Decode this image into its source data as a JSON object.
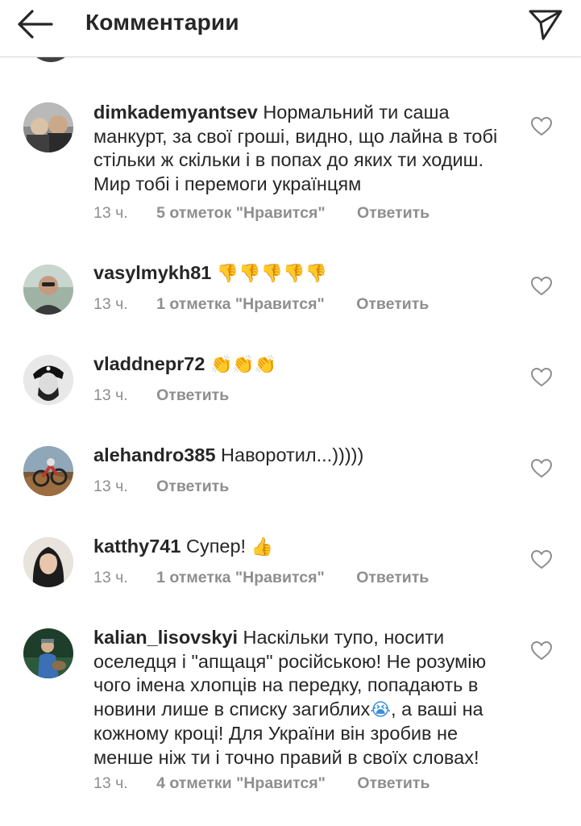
{
  "header": {
    "title": "Комментарии",
    "back_icon": "arrow-left-icon",
    "send_icon": "paper-plane-icon"
  },
  "colors": {
    "text": "#262626",
    "meta": "#8e8e8e",
    "divider": "#dbdbdb",
    "emoji": "#f4b400"
  },
  "comments": [
    {
      "username": "dimkademyantsev",
      "text": "Нормальний ти саша манкурт, за свої гроші, видно, що лайна в тобі стільки ж скільки і в попах до яких ти ходиш. Мир тобі і перемоги українцям",
      "emoji": "",
      "text_after": "",
      "time": "13 ч.",
      "likes": "5 отметок \"Нравится\"",
      "reply": "Ответить"
    },
    {
      "username": "vasylmykh81",
      "text": "",
      "emoji": "👎👎👎👎👎",
      "text_after": "",
      "time": "13 ч.",
      "likes": "1 отметка \"Нравится\"",
      "reply": "Ответить"
    },
    {
      "username": "vladdnepr72",
      "text": "",
      "emoji": "👏👏👏",
      "text_after": "",
      "time": "13 ч.",
      "likes": "",
      "reply": "Ответить"
    },
    {
      "username": "alehandro385",
      "text": "Наворотил...)))))",
      "emoji": "",
      "text_after": "",
      "time": "13 ч.",
      "likes": "",
      "reply": "Ответить"
    },
    {
      "username": "katthy741",
      "text": "Супер!",
      "emoji": "👍",
      "text_after": "",
      "time": "13 ч.",
      "likes": "1 отметка \"Нравится\"",
      "reply": "Ответить"
    },
    {
      "username": "kalian_lisovskyi",
      "text": "Наскільки тупо, носити оселедця і \"апщаця\" російською! Не розумію чого імена хлопців на передку, попадають в новини лише в списку загиблих",
      "emoji": "😭",
      "text_after": ", а ваші на кожному кроці! Для України він зробив не менше ніж ти і точно правий в своїх словах!",
      "time": "13 ч.",
      "likes": "4 отметки \"Нравится\"",
      "reply": "Ответить"
    }
  ]
}
